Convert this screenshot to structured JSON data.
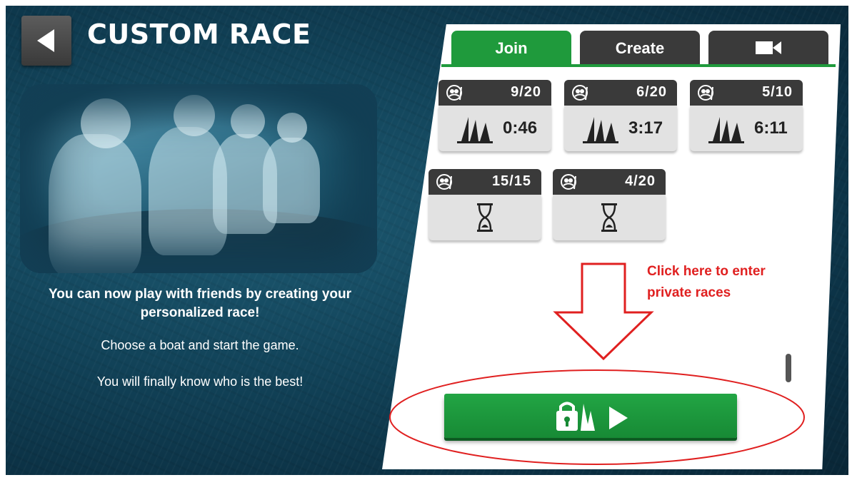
{
  "screen": {
    "title": "CUSTOM RACE",
    "description_main": "You can now play with friends by creating your personalized race!",
    "description_2": "Choose a boat and start the game.",
    "description_3": "You will finally know who is the best!"
  },
  "tabs": {
    "join": "Join",
    "create": "Create",
    "video_icon": "video-camera-icon"
  },
  "races": [
    {
      "players": "9/20",
      "time": "0:46",
      "status": "started"
    },
    {
      "players": "6/20",
      "time": "3:17",
      "status": "started"
    },
    {
      "players": "5/10",
      "time": "6:11",
      "status": "started"
    },
    {
      "players": "15/15",
      "time": "",
      "status": "waiting"
    },
    {
      "players": "4/20",
      "time": "",
      "status": "waiting"
    }
  ],
  "private_race_button": {
    "icons": [
      "lock-sail-icon",
      "play-icon"
    ]
  },
  "annotation": {
    "line1": "Click here to enter",
    "line2": "private races",
    "color": "#e02020"
  },
  "colors": {
    "accent_green": "#1f9a3c",
    "dark_tab": "#3a3a3a"
  }
}
